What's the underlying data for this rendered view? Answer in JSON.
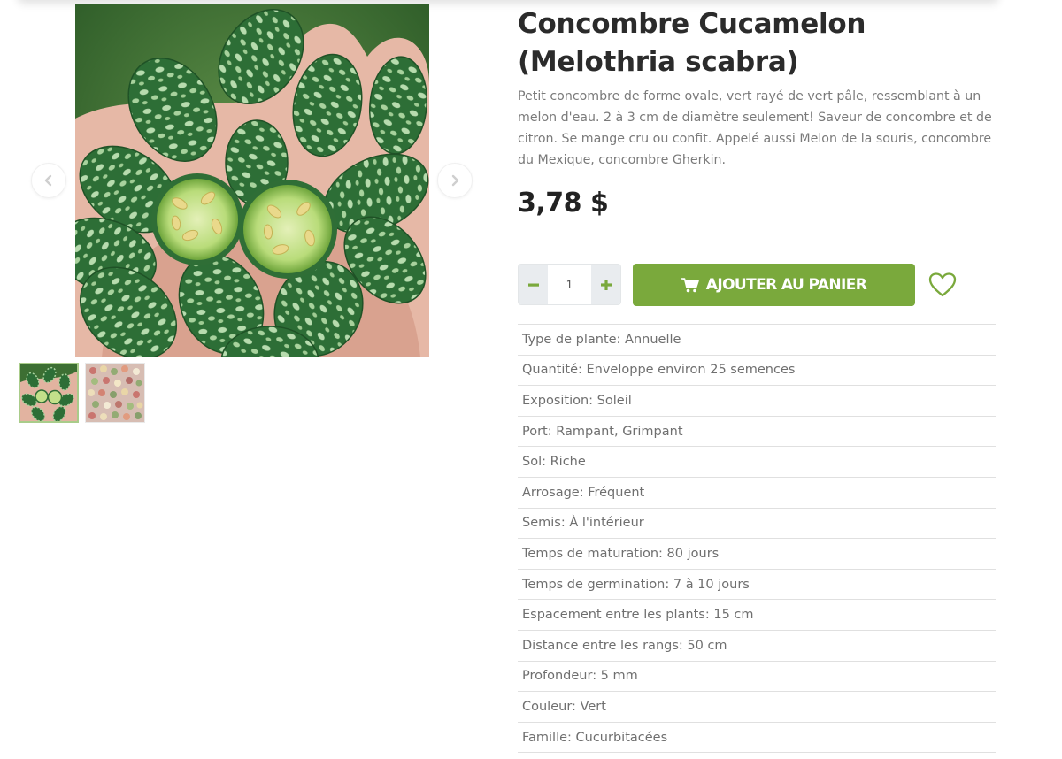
{
  "product": {
    "title": "Concombre Cucamelon (Melothria scabra)",
    "description": "Petit concombre de forme ovale, vert rayé de vert pâle, ressemblant à un melon d'eau. 2 à 3 cm de diamètre seulement! Saveur de concombre et de citron. Se mange cru ou confit. Appelé aussi Melon de la souris, concombre du Mexique, concombre Gherkin.",
    "price": "3,78 $"
  },
  "cart": {
    "quantity": "1",
    "decrement_icon": "minus-icon",
    "increment_icon": "plus-icon",
    "add_to_cart_label": "AJOUTER AU PANIER",
    "cart_icon": "shopping-cart-icon",
    "wishlist_icon": "heart-icon"
  },
  "gallery": {
    "prev_icon": "chevron-left-icon",
    "next_icon": "chevron-right-icon",
    "thumbnail_count": 2,
    "active_thumbnail": 1
  },
  "specs": [
    "Type de plante: Annuelle",
    "Quantité: Enveloppe environ 25 semences",
    "Exposition: Soleil",
    "Port: Rampant, Grimpant",
    "Sol: Riche",
    "Arrosage: Fréquent",
    "Semis: À l'intérieur",
    "Temps de maturation: 80 jours",
    "Temps de germination: 7 à 10 jours",
    "Espacement entre les plants: 15 cm",
    "Distance entre les rangs: 50 cm",
    "Profondeur: 5 mm",
    "Couleur: Vert",
    "Famille: Cucurbitacées"
  ],
  "colors": {
    "accent_green": "#7aa93c",
    "thumb_active_border": "#a9cc8a",
    "title_text": "#2b2b2b",
    "body_text": "#7a7a7a"
  }
}
